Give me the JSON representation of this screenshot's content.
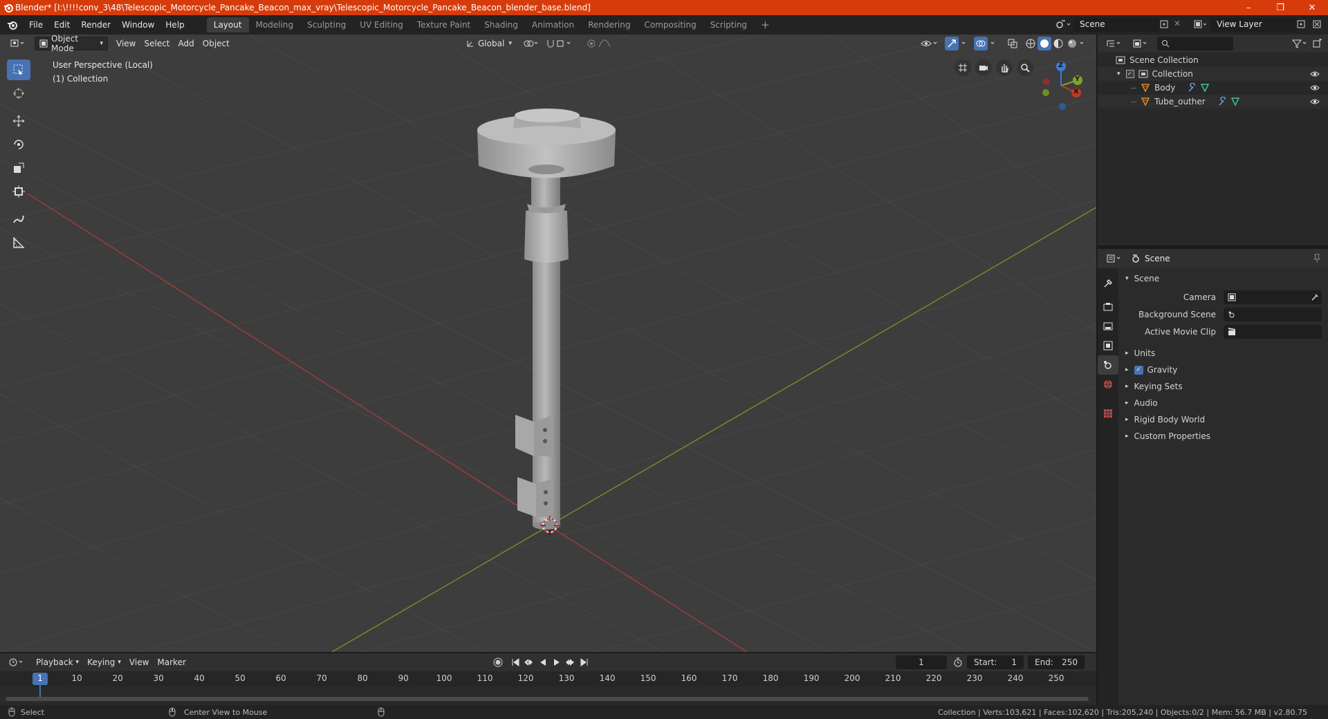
{
  "window": {
    "title": "Blender* [I:\\!!!!conv_3\\48\\Telescopic_Motorcycle_Pancake_Beacon_max_vray\\Telescopic_Motorcycle_Pancake_Beacon_blender_base.blend]",
    "minimize": "–",
    "maximize": "❐",
    "close": "✕"
  },
  "menu": {
    "items": [
      "File",
      "Edit",
      "Render",
      "Window",
      "Help"
    ],
    "workspaces": [
      "Layout",
      "Modeling",
      "Sculpting",
      "UV Editing",
      "Texture Paint",
      "Shading",
      "Animation",
      "Rendering",
      "Compositing",
      "Scripting"
    ],
    "active_workspace": "Layout",
    "add_tab": "+",
    "scene_label": "Scene",
    "view_layer_label": "View Layer"
  },
  "viewport": {
    "mode": "Object Mode",
    "menus": [
      "View",
      "Select",
      "Add",
      "Object"
    ],
    "orientation": "Global",
    "info_line1": "User Perspective (Local)",
    "info_line2": "(1) Collection",
    "gizmo": {
      "z": "Z",
      "y": "Y",
      "x": "X"
    }
  },
  "outliner": {
    "search_placeholder": "",
    "root": "Scene Collection",
    "collection": "Collection",
    "objects": [
      "Body",
      "Tube_outher"
    ]
  },
  "properties": {
    "context": "Scene",
    "panel_title": "Scene",
    "camera_label": "Camera",
    "background_scene_label": "Background Scene",
    "active_movie_clip_label": "Active Movie Clip",
    "sections": [
      "Units",
      "Gravity",
      "Keying Sets",
      "Audio",
      "Rigid Body World",
      "Custom Properties"
    ],
    "gravity_checked": true
  },
  "timeline": {
    "menus": [
      "Playback",
      "Keying",
      "View",
      "Marker"
    ],
    "current_frame": "1",
    "start_label": "Start:",
    "start_value": "1",
    "end_label": "End:",
    "end_value": "250",
    "ruler_ticks": [
      "1",
      "10",
      "20",
      "30",
      "40",
      "50",
      "60",
      "70",
      "80",
      "90",
      "100",
      "110",
      "120",
      "130",
      "140",
      "150",
      "160",
      "170",
      "180",
      "190",
      "200",
      "210",
      "220",
      "230",
      "240",
      "250"
    ]
  },
  "status": {
    "left_action": "Select",
    "mid_action": "Center View to Mouse",
    "stats": "Collection | Verts:103,621 | Faces:102,620 | Tris:205,240 | Objects:0/2 | Mem: 56.7 MB | v2.80.75"
  },
  "colors": {
    "accent": "#4772b3",
    "titlebar": "#d63c0b",
    "x_axis": "#c0392b",
    "y_axis": "#7fa32a",
    "object_orange": "#e08a2c"
  }
}
